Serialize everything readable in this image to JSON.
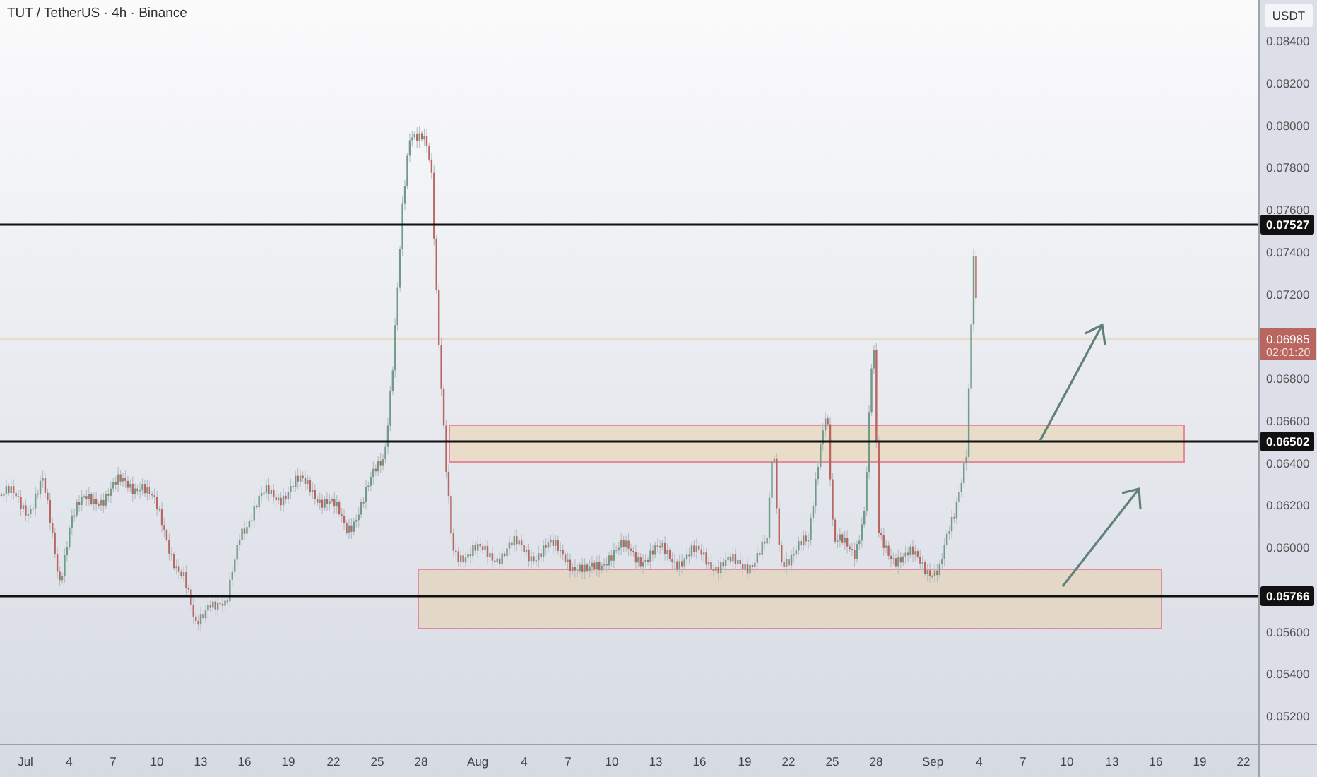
{
  "header": {
    "title": "TUT / TetherUS · 4h · Binance"
  },
  "price_axis": {
    "currency": "USDT",
    "ticks": [
      "0.08400",
      "0.08200",
      "0.08000",
      "0.07800",
      "0.07600",
      "0.07400",
      "0.07200",
      "0.06800",
      "0.06600",
      "0.06400",
      "0.06200",
      "0.06000",
      "0.05600",
      "0.05400",
      "0.05200"
    ]
  },
  "price_labels": [
    {
      "kind": "level",
      "text": "0.07527"
    },
    {
      "kind": "current",
      "text": "0.06985",
      "countdown": "02:01:20"
    },
    {
      "kind": "level",
      "text": "0.06502"
    },
    {
      "kind": "level",
      "text": "0.05766"
    }
  ],
  "date_axis": {
    "ticks": [
      "Jul",
      "4",
      "7",
      "10",
      "13",
      "16",
      "19",
      "22",
      "25",
      "28",
      "Aug",
      "4",
      "7",
      "10",
      "13",
      "16",
      "19",
      "22",
      "25",
      "28",
      "Sep",
      "4",
      "7",
      "10",
      "13",
      "16",
      "19",
      "22"
    ]
  }
}
